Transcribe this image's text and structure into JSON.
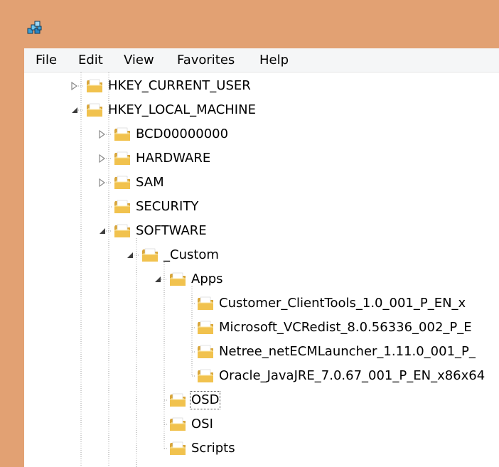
{
  "window": {
    "app_icon": "registry-editor-icon",
    "accent_color": "#e2a173"
  },
  "menu": {
    "items": [
      {
        "label": "File"
      },
      {
        "label": "Edit"
      },
      {
        "label": "View"
      },
      {
        "label": "Favorites"
      },
      {
        "label": "Help"
      }
    ]
  },
  "tree": {
    "selected": "OSD",
    "nodes": [
      {
        "label": "HKEY_CURRENT_USER",
        "depth": 0,
        "expander": "collapsed"
      },
      {
        "label": "HKEY_LOCAL_MACHINE",
        "depth": 0,
        "expander": "expanded"
      },
      {
        "label": "BCD00000000",
        "depth": 1,
        "expander": "collapsed"
      },
      {
        "label": "HARDWARE",
        "depth": 1,
        "expander": "collapsed"
      },
      {
        "label": "SAM",
        "depth": 1,
        "expander": "collapsed"
      },
      {
        "label": "SECURITY",
        "depth": 1,
        "expander": "none"
      },
      {
        "label": "SOFTWARE",
        "depth": 1,
        "expander": "expanded"
      },
      {
        "label": "_Custom",
        "depth": 2,
        "expander": "expanded"
      },
      {
        "label": "Apps",
        "depth": 3,
        "expander": "expanded"
      },
      {
        "label": "Customer_ClientTools_1.0_001_P_EN_x",
        "depth": 4,
        "expander": "none"
      },
      {
        "label": "Microsoft_VCRedist_8.0.56336_002_P_E",
        "depth": 4,
        "expander": "none"
      },
      {
        "label": "Netree_netECMLauncher_1.11.0_001_P_",
        "depth": 4,
        "expander": "none"
      },
      {
        "label": "Oracle_JavaJRE_7.0.67_001_P_EN_x86x64",
        "depth": 4,
        "expander": "none"
      },
      {
        "label": "OSD",
        "depth": 3,
        "expander": "none",
        "selected": true
      },
      {
        "label": "OSI",
        "depth": 3,
        "expander": "none"
      },
      {
        "label": "Scripts",
        "depth": 3,
        "expander": "none"
      }
    ]
  }
}
